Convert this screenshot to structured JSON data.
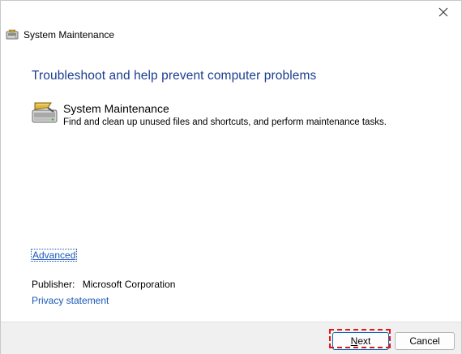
{
  "window": {
    "title": "System Maintenance",
    "close_symbol": "✕"
  },
  "main": {
    "heading": "Troubleshoot and help prevent computer problems",
    "task": {
      "title": "System Maintenance",
      "description": "Find and clean up unused files and shortcuts, and perform maintenance tasks.",
      "icon": "maintenance-drive-icon"
    },
    "advanced_label": "Advanced",
    "publisher_label": "Publisher:",
    "publisher_value": "Microsoft Corporation",
    "privacy_label": "Privacy statement"
  },
  "footer": {
    "next_mnemonic": "N",
    "next_rest": "ext",
    "cancel_label": "Cancel"
  },
  "colors": {
    "heading": "#1a3d8f",
    "link": "#1a57b8",
    "highlight": "#e11818",
    "footer_bg": "#f0f0f0"
  }
}
